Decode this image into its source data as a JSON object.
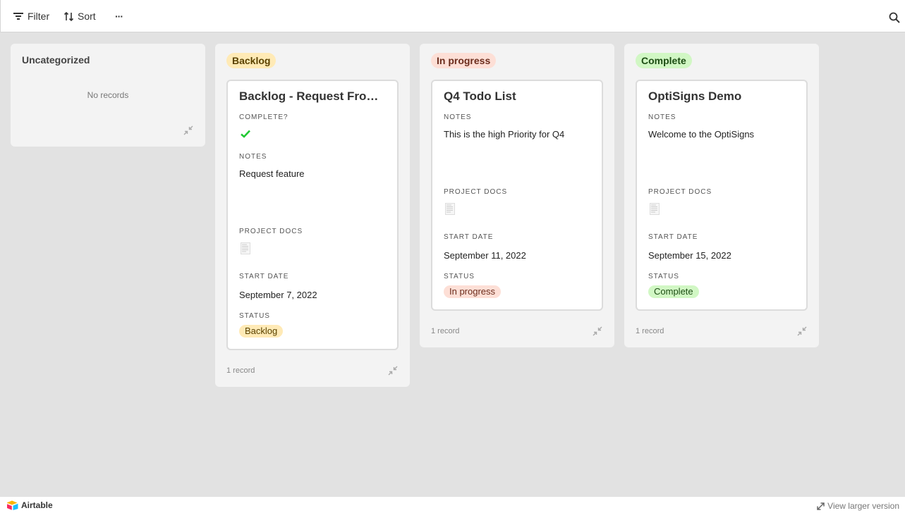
{
  "toolbar": {
    "filter_label": "Filter",
    "sort_label": "Sort",
    "more_label": "···"
  },
  "columns": [
    {
      "title": "Uncategorized",
      "empty_text": "No records"
    },
    {
      "title": "Backlog",
      "count_text": "1 record",
      "card": {
        "title": "Backlog - Request From U...",
        "complete_label": "COMPLETE?",
        "complete_value": true,
        "notes_label": "NOTES",
        "notes": "Request feature",
        "docs_label": "PROJECT DOCS",
        "start_label": "START DATE",
        "start_date": "September 7, 2022",
        "status_label": "STATUS",
        "status": "Backlog"
      }
    },
    {
      "title": "In progress",
      "count_text": "1 record",
      "card": {
        "title": "Q4 Todo List",
        "notes_label": "NOTES",
        "notes": "This is the high Priority for Q4",
        "docs_label": "PROJECT DOCS",
        "start_label": "START DATE",
        "start_date": "September 11, 2022",
        "status_label": "STATUS",
        "status": "In progress"
      }
    },
    {
      "title": "Complete",
      "count_text": "1 record",
      "card": {
        "title": "OptiSigns Demo",
        "notes_label": "NOTES",
        "notes": "Welcome to the OptiSigns",
        "docs_label": "PROJECT DOCS",
        "start_label": "START DATE",
        "start_date": "September 15, 2022",
        "status_label": "STATUS",
        "status": "Complete"
      }
    }
  ],
  "footer": {
    "brand": "Airtable",
    "view_larger": "View larger version"
  },
  "colors": {
    "backlog": "#ffeab6",
    "in_progress": "#fddfd6",
    "complete": "#d1f7c4",
    "check": "#20c933"
  },
  "icons": [
    "filter-icon",
    "sort-icon",
    "more-icon",
    "search-icon",
    "check-icon",
    "document-icon",
    "collapse-icon",
    "expand-icon",
    "airtable-logo"
  ]
}
